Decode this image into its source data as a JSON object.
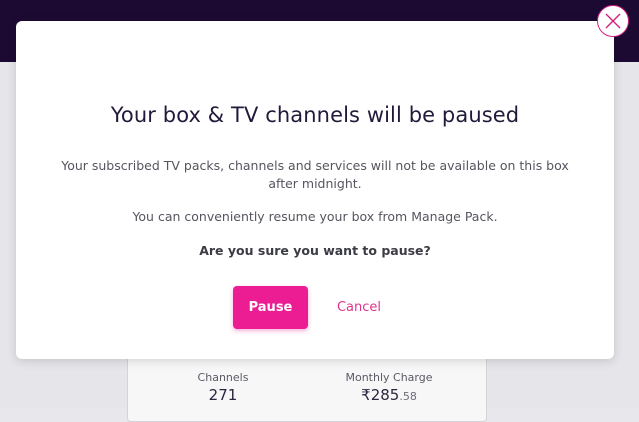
{
  "modal": {
    "title": "Your box & TV channels will be paused",
    "description": "Your subscribed TV packs, channels and services will not be available on this box after midnight.",
    "resume_note": "You can conveniently resume your box from Manage Pack.",
    "confirm_question": "Are you sure you want to pause?",
    "pause_label": "Pause",
    "cancel_label": "Cancel",
    "close_icon": "close-icon"
  },
  "background_card": {
    "channels_label": "Channels",
    "channels_value": "271",
    "monthly_charge_label": "Monthly Charge",
    "monthly_charge_main": "₹285",
    "monthly_charge_decimal": ".58"
  },
  "colors": {
    "accent": "#ec1d93",
    "header_bg": "#1d0a33",
    "title_text": "#23193a"
  }
}
